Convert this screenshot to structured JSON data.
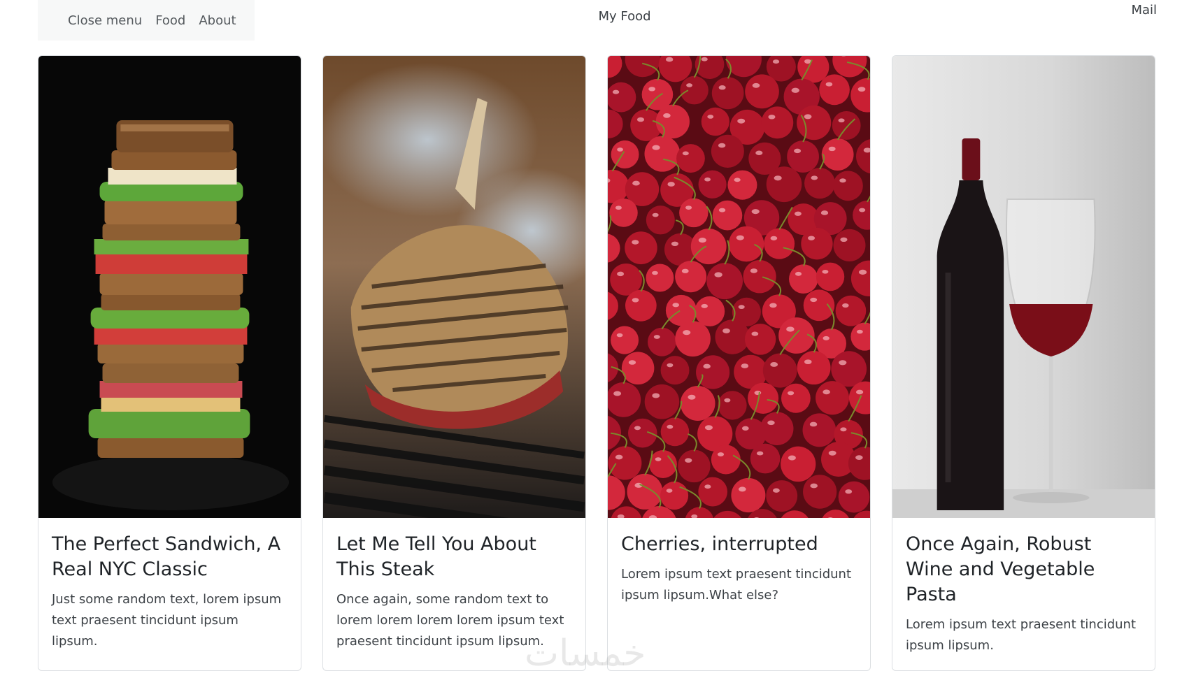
{
  "nav": {
    "close_menu": "Close menu",
    "food": "Food",
    "about": "About",
    "brand": "My Food",
    "mail": "Mail"
  },
  "cards": [
    {
      "title": "The Perfect Sandwich, A Real NYC Classic",
      "text": "Just some random text, lorem ipsum text praesent tincidunt ipsum lipsum.",
      "image": "stacked-sandwich-photo"
    },
    {
      "title": "Let Me Tell You About This Steak",
      "text": "Once again, some random text to lorem lorem lorem lorem ipsum text praesent tincidunt ipsum lipsum.",
      "image": "grilled-steak-photo"
    },
    {
      "title": "Cherries, interrupted",
      "text": "Lorem ipsum text praesent tincidunt ipsum lipsum.What else?",
      "image": "cherries-photo"
    },
    {
      "title": "Once Again, Robust Wine and Vegetable Pasta",
      "text": "Lorem ipsum text praesent tincidunt ipsum lipsum.",
      "image": "red-wine-photo"
    }
  ],
  "watermark": "خمسات"
}
